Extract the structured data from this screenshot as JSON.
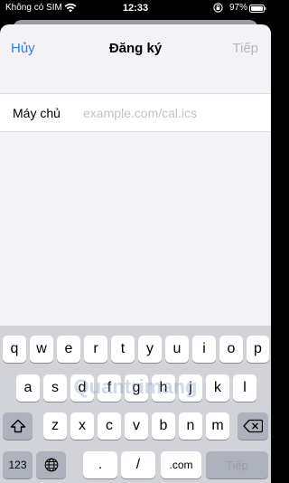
{
  "status_bar": {
    "carrier": "Không có SIM",
    "time": "12:33",
    "battery_percent": "97%",
    "icons": [
      "wifi-icon",
      "orientation-lock-icon",
      "battery-icon"
    ]
  },
  "nav": {
    "cancel_label": "Hủy",
    "title": "Đăng ký",
    "next_label": "Tiếp"
  },
  "form": {
    "server_label": "Máy chủ",
    "server_placeholder": "example.com/cal.ics",
    "server_value": ""
  },
  "keyboard": {
    "row1": [
      "q",
      "w",
      "e",
      "r",
      "t",
      "y",
      "u",
      "i",
      "o",
      "p"
    ],
    "row2": [
      "a",
      "s",
      "d",
      "f",
      "g",
      "h",
      "j",
      "k",
      "l"
    ],
    "row3": [
      "z",
      "x",
      "c",
      "v",
      "b",
      "n",
      "m"
    ],
    "numbers_label": "123",
    "dot_label": ".",
    "slash_label": "/",
    "dotcom_label": ".com",
    "return_label": "Tiếp",
    "icons": [
      "shift-icon",
      "delete-icon",
      "globe-icon"
    ]
  },
  "watermark": "Quantrimang",
  "colors": {
    "accent": "#2f7cf6",
    "disabled": "#b8b8bd",
    "placeholder": "#c4c4c8",
    "sheet_bg": "#f2f2f7",
    "keyboard_bg": "#d1d3d9",
    "dark_key": "#adb2bc"
  }
}
